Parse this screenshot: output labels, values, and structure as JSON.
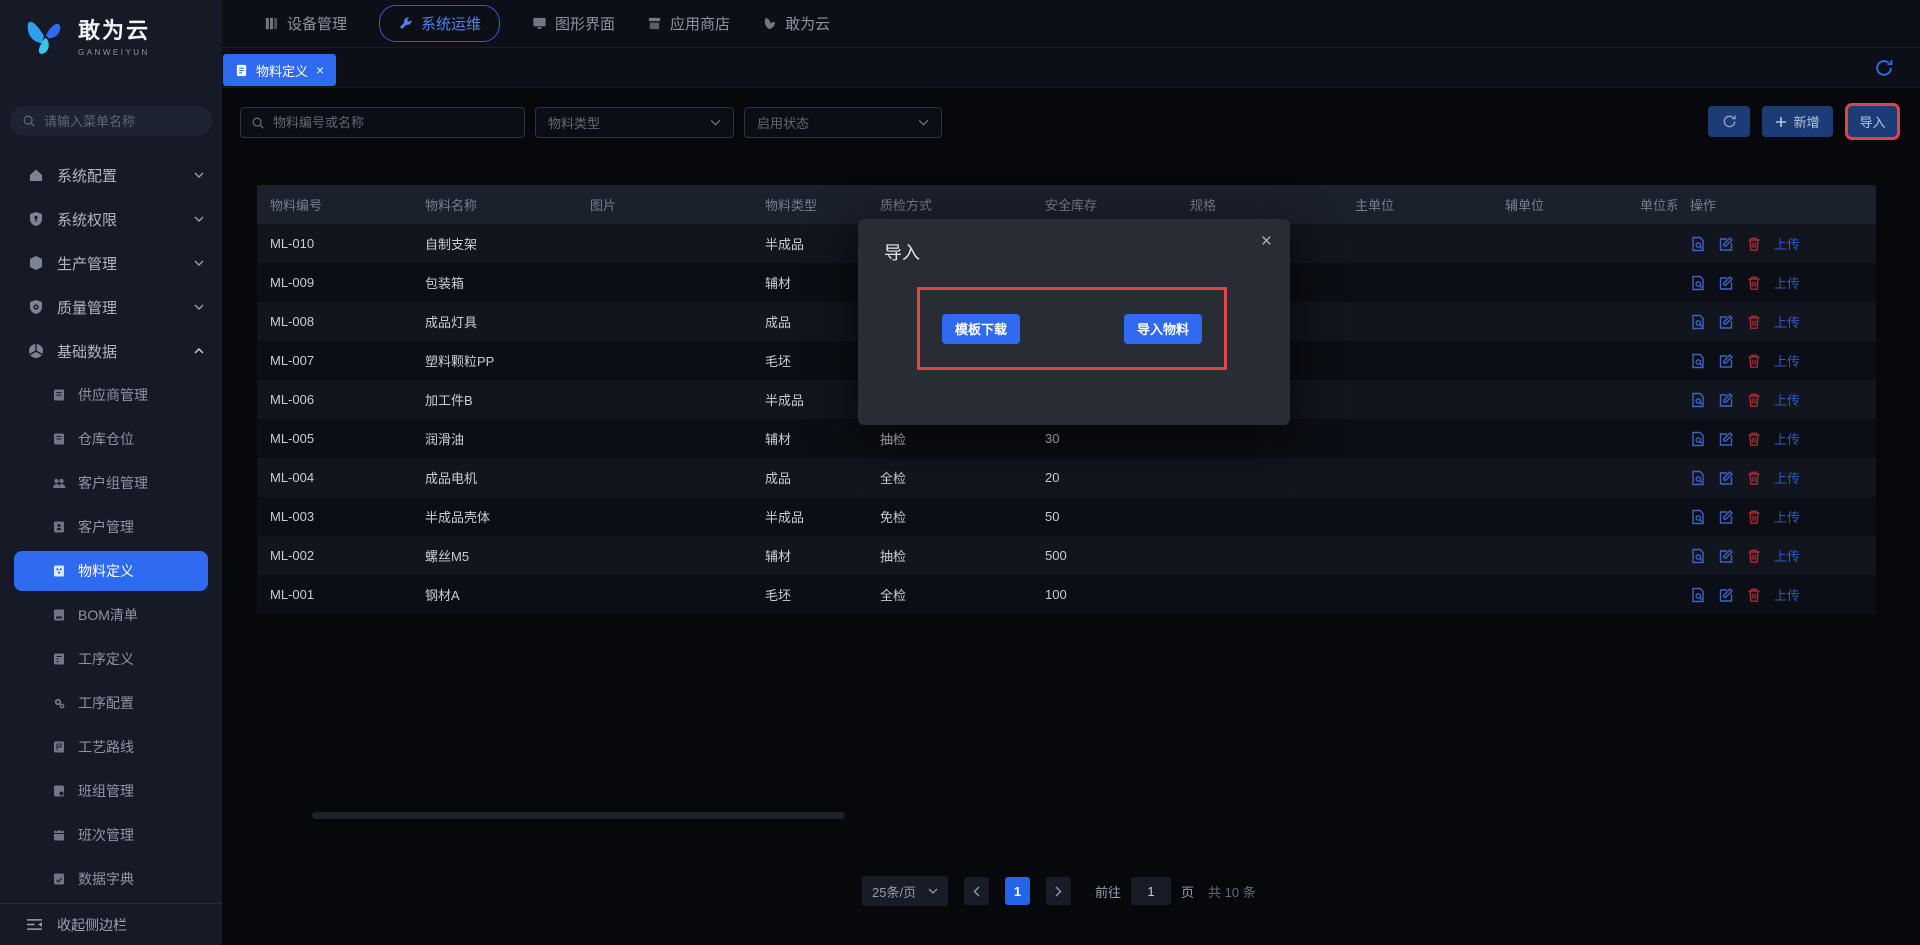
{
  "brand": {
    "name": "敢为云",
    "subtitle": "GANWEIYUN"
  },
  "topnav": {
    "items": [
      {
        "label": "设备管理",
        "icon": "equipment-icon",
        "active": false
      },
      {
        "label": "系统运维",
        "icon": "wrench-icon",
        "active": true
      },
      {
        "label": "图形界面",
        "icon": "screen-icon",
        "active": false
      },
      {
        "label": "应用商店",
        "icon": "store-icon",
        "active": false
      },
      {
        "label": "敢为云",
        "icon": "brand-icon",
        "active": false
      }
    ]
  },
  "tabbar": {
    "active_tab": "物料定义",
    "close_glyph": "×"
  },
  "sidebar": {
    "search_placeholder": "请输入菜单名称",
    "groups": [
      {
        "label": "系统配置",
        "icon": "home-icon",
        "state": "collapsed"
      },
      {
        "label": "系统权限",
        "icon": "permission-icon",
        "state": "collapsed"
      },
      {
        "label": "生产管理",
        "icon": "production-icon",
        "state": "collapsed"
      },
      {
        "label": "质量管理",
        "icon": "quality-icon",
        "state": "collapsed"
      },
      {
        "label": "基础数据",
        "icon": "base-data-icon",
        "state": "expanded"
      }
    ],
    "subitems": [
      {
        "label": "供应商管理",
        "active": false
      },
      {
        "label": "仓库仓位",
        "active": false
      },
      {
        "label": "客户组管理",
        "active": false
      },
      {
        "label": "客户管理",
        "active": false
      },
      {
        "label": "物料定义",
        "active": true
      },
      {
        "label": "BOM清单",
        "active": false
      },
      {
        "label": "工序定义",
        "active": false
      },
      {
        "label": "工序配置",
        "active": false
      },
      {
        "label": "工艺路线",
        "active": false
      },
      {
        "label": "班组管理",
        "active": false
      },
      {
        "label": "班次管理",
        "active": false
      },
      {
        "label": "数据字典",
        "active": false
      }
    ],
    "collapse_label": "收起侧边栏"
  },
  "filters": {
    "search_placeholder": "物料编号或名称",
    "material_type": "物料类型",
    "enable_status": "启用状态"
  },
  "toolbar": {
    "add_label": "新增",
    "import_label": "导入"
  },
  "table": {
    "columns": [
      "物料编号",
      "物料名称",
      "图片",
      "物料类型",
      "质检方式",
      "安全库存",
      "规格",
      "主单位",
      "辅单位",
      "单位系",
      "操作"
    ],
    "upload_label": "上传",
    "rows": [
      {
        "code": "ML-010",
        "name": "自制支架",
        "type": "半成品",
        "qc": "",
        "stock": ""
      },
      {
        "code": "ML-009",
        "name": "包装箱",
        "type": "辅材",
        "qc": "",
        "stock": ""
      },
      {
        "code": "ML-008",
        "name": "成品灯具",
        "type": "成品",
        "qc": "",
        "stock": ""
      },
      {
        "code": "ML-007",
        "name": "塑料颗粒PP",
        "type": "毛坯",
        "qc": "",
        "stock": ""
      },
      {
        "code": "ML-006",
        "name": "加工件B",
        "type": "半成品",
        "qc": "",
        "stock": ""
      },
      {
        "code": "ML-005",
        "name": "润滑油",
        "type": "辅材",
        "qc": "抽检",
        "stock": "30"
      },
      {
        "code": "ML-004",
        "name": "成品电机",
        "type": "成品",
        "qc": "全检",
        "stock": "20"
      },
      {
        "code": "ML-003",
        "name": "半成品壳体",
        "type": "半成品",
        "qc": "免检",
        "stock": "50"
      },
      {
        "code": "ML-002",
        "name": "螺丝M5",
        "type": "辅材",
        "qc": "抽检",
        "stock": "500"
      },
      {
        "code": "ML-001",
        "name": "钢材A",
        "type": "毛坯",
        "qc": "全检",
        "stock": "100"
      }
    ]
  },
  "modal": {
    "title": "导入",
    "template_button": "模板下载",
    "import_button": "导入物料"
  },
  "pagination": {
    "page_size": "25条/页",
    "current_page": "1",
    "goto_prefix": "前往",
    "goto_value": "1",
    "goto_suffix": "页",
    "total": "共 10 条"
  },
  "colors": {
    "accent": "#2e6bf0",
    "annotation_red": "#e0453e",
    "danger_icon": "#a62b33"
  }
}
